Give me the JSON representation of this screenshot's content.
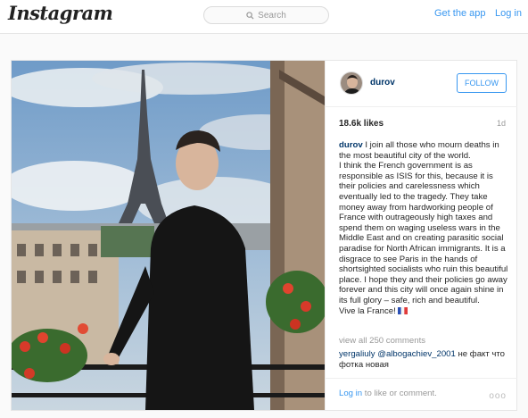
{
  "header": {
    "logo": "Instagram",
    "search_placeholder": "Search",
    "get_app": "Get the app",
    "login": "Log in"
  },
  "post": {
    "username": "durov",
    "follow_label": "FOLLOW",
    "likes": "18.6k likes",
    "age": "1d",
    "caption_author": "durov",
    "caption_lines": [
      "I join all those who mourn deaths in the most beautiful city of the world.",
      "I think the French government is as responsible as ISIS for this, because it is their policies and carelessness which eventually led to the tragedy. They take money away from hardworking people of France with outrageously high taxes and spend them on waging useless wars in the Middle East and on creating parasitic social paradise for North African immigrants. It is a disgrace to see Paris in the hands of shortsighted socialists who ruin this beautiful place. I hope they and their policies go away forever and this city will once again shine in its full glory – safe, rich and beautiful.",
      "Vive la France!"
    ],
    "view_all_comments": "view all 250 comments",
    "comment": {
      "user": "yergaliuly",
      "mention": "@albogachiev_2001",
      "text": "не факт что фотка новая"
    },
    "footer_link": "Log in",
    "footer_text": " to like or comment.",
    "more_label": "ooo"
  }
}
